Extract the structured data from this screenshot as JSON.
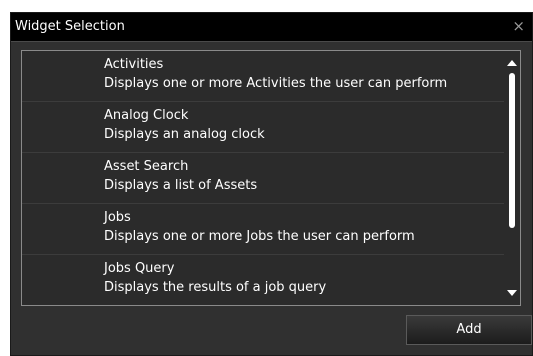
{
  "dialog": {
    "title": "Widget Selection",
    "close_glyph": "×",
    "close_icon": "close-icon"
  },
  "widgets": [
    {
      "name": "Activities",
      "description": "Displays one or more Activities the user can perform"
    },
    {
      "name": "Analog Clock",
      "description": "Displays an analog clock"
    },
    {
      "name": "Asset Search",
      "description": "Displays a list of Assets"
    },
    {
      "name": "Jobs",
      "description": "Displays one or more Jobs the user can perform"
    },
    {
      "name": "Jobs Query",
      "description": "Displays the results of a job query"
    }
  ],
  "scrollbar": {
    "up_icon": "scroll-up-arrow-icon",
    "down_icon": "scroll-down-arrow-icon"
  },
  "footer": {
    "add_label": "Add"
  },
  "colors": {
    "dialog_background": "#303030",
    "titlebar_background": "#000000",
    "text": "#ffffff"
  }
}
